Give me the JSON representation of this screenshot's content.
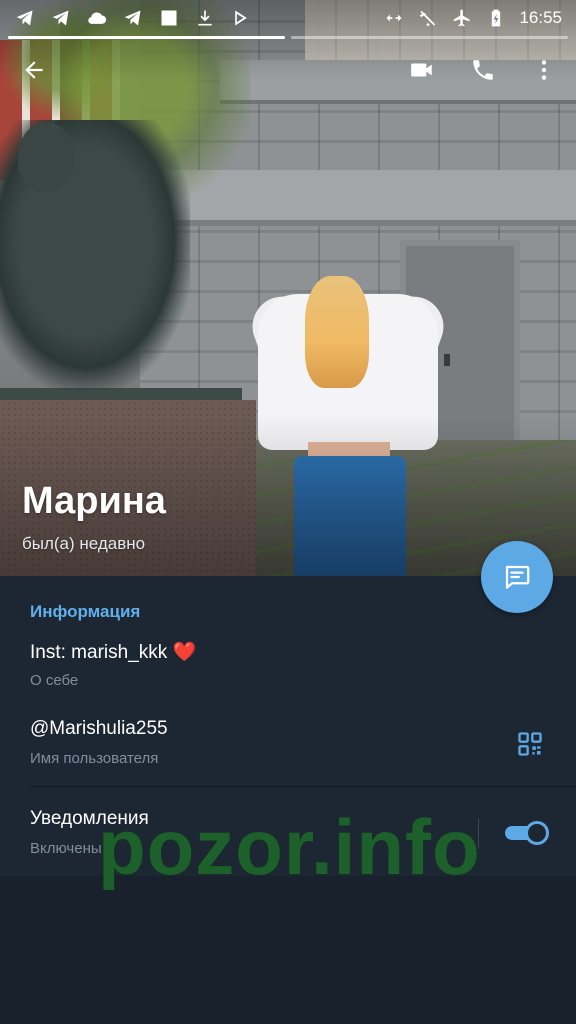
{
  "status_bar": {
    "time": "16:55",
    "left_icons": [
      "telegram-icon",
      "telegram-icon",
      "cloud-icon",
      "telegram-icon",
      "image-icon",
      "download-icon",
      "play-store-icon"
    ],
    "right_icons": [
      "data-saver-icon",
      "wifi-off-icon",
      "airplane-icon",
      "battery-charging-icon"
    ]
  },
  "topbar": {
    "back_icon": "arrow-left-icon",
    "video_icon": "video-call-icon",
    "call_icon": "phone-icon",
    "menu_icon": "more-vertical-icon"
  },
  "profile": {
    "name": "Марина",
    "last_seen": "был(а) недавно"
  },
  "info": {
    "section_title": "Информация",
    "bio_value_prefix": "Inst: marish_kkk",
    "bio_emoji": "❤️",
    "bio_label": "О себе",
    "username_value": "@Marishulia255",
    "username_label": "Имя пользователя",
    "notifications_value": "Уведомления",
    "notifications_label": "Включены",
    "notifications_enabled": true
  },
  "watermark": "pozor.info",
  "colors": {
    "accent": "#5ca9e6",
    "background": "#1d2733",
    "watermark": "#1e6a2b"
  }
}
